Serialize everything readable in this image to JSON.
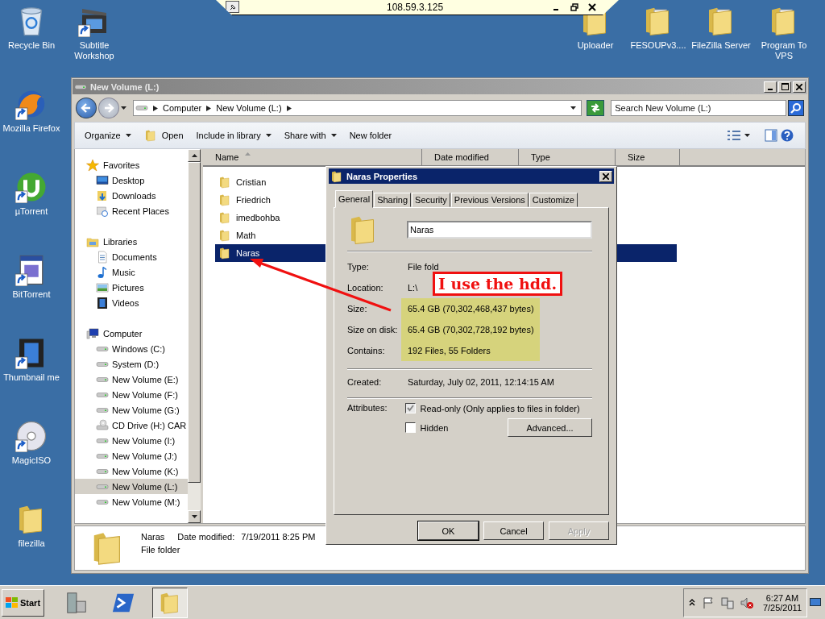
{
  "remote_bar": {
    "title": "108.59.3.125"
  },
  "desktop_left": [
    {
      "label": "Recycle Bin",
      "kind": "recycle"
    },
    {
      "label": "Mozilla Firefox",
      "kind": "browser"
    },
    {
      "label": "µTorrent",
      "kind": "torrent"
    },
    {
      "label": "BitTorrent",
      "kind": "app"
    },
    {
      "label": "Thumbnail me",
      "kind": "film"
    },
    {
      "label": "MagicISO",
      "kind": "disc"
    },
    {
      "label": "filezilla",
      "kind": "folder"
    }
  ],
  "desktop_top": [
    {
      "label": "Subtitle Workshop",
      "kind": "clapper"
    }
  ],
  "desktop_right": [
    {
      "label": "Uploader",
      "kind": "folder"
    },
    {
      "label": "FESOUPv3....",
      "kind": "docfolder"
    },
    {
      "label": "FileZilla Server",
      "kind": "docfolder"
    },
    {
      "label": "Program To VPS",
      "kind": "docfolder"
    }
  ],
  "explorer": {
    "title": "New Volume (L:)",
    "breadcrumb": [
      "Computer",
      "New Volume (L:)"
    ],
    "search": {
      "placeholder": "Search New Volume (L:)"
    },
    "toolbar": [
      {
        "label": "Organize",
        "kind": "command",
        "dropdown": true
      },
      {
        "label": "Open",
        "kind": "open",
        "dropdown": false
      },
      {
        "label": "Include in library",
        "kind": "command",
        "dropdown": true
      },
      {
        "label": "Share with",
        "kind": "command",
        "dropdown": true
      },
      {
        "label": "New folder",
        "kind": "command",
        "dropdown": false
      }
    ],
    "nav": [
      {
        "label": "Favorites",
        "kind": "star",
        "children": [
          {
            "label": "Desktop",
            "kind": "desktop",
            "selected": false
          },
          {
            "label": "Downloads",
            "kind": "downloads",
            "selected": false
          },
          {
            "label": "Recent Places",
            "kind": "recent",
            "selected": false
          }
        ]
      },
      {
        "label": "Libraries",
        "kind": "library",
        "children": [
          {
            "label": "Documents",
            "kind": "document",
            "selected": false
          },
          {
            "label": "Music",
            "kind": "music",
            "selected": false
          },
          {
            "label": "Pictures",
            "kind": "pictures",
            "selected": false
          },
          {
            "label": "Videos",
            "kind": "videos",
            "selected": false
          }
        ]
      },
      {
        "label": "Computer",
        "kind": "computer",
        "children": [
          {
            "label": "Windows (C:)",
            "kind": "drive",
            "selected": false
          },
          {
            "label": "System (D:)",
            "kind": "drive",
            "selected": false
          },
          {
            "label": "New Volume (E:)",
            "kind": "drive",
            "selected": false
          },
          {
            "label": "New Volume (F:)",
            "kind": "drive",
            "selected": false
          },
          {
            "label": "New Volume (G:)",
            "kind": "drive",
            "selected": false
          },
          {
            "label": "CD Drive (H:) CAR",
            "kind": "cd",
            "selected": false
          },
          {
            "label": "New Volume (I:)",
            "kind": "drive",
            "selected": false
          },
          {
            "label": "New Volume (J:)",
            "kind": "drive",
            "selected": false
          },
          {
            "label": "New Volume (K:)",
            "kind": "drive",
            "selected": false
          },
          {
            "label": "New Volume (L:)",
            "kind": "drive",
            "selected": true
          },
          {
            "label": "New Volume (M:)",
            "kind": "drive",
            "selected": false
          }
        ]
      }
    ],
    "columns": [
      {
        "label": "Name",
        "sorted": true
      },
      {
        "label": "Date modified",
        "sorted": false
      },
      {
        "label": "Type",
        "sorted": false
      },
      {
        "label": "Size",
        "sorted": false
      }
    ],
    "files": [
      {
        "name": "Cristian",
        "selected": false
      },
      {
        "name": "Friedrich",
        "selected": false
      },
      {
        "name": "imedbohba",
        "selected": false
      },
      {
        "name": "Math",
        "selected": false
      },
      {
        "name": "Naras",
        "selected": true
      }
    ],
    "details": {
      "name": "Naras",
      "date_label": "Date modified:",
      "date": "7/19/2011 8:25 PM",
      "type": "File folder"
    }
  },
  "dialog": {
    "title": "Naras Properties",
    "tabs": [
      {
        "label": "General",
        "selected": true
      },
      {
        "label": "Sharing",
        "selected": false
      },
      {
        "label": "Security",
        "selected": false
      },
      {
        "label": "Previous Versions",
        "selected": false
      },
      {
        "label": "Customize",
        "selected": false
      }
    ],
    "name_value": "Naras",
    "info_groups": [
      [
        {
          "label": "Type:",
          "value": "File fold",
          "highlight": false
        },
        {
          "label": "Location:",
          "value": "L:\\",
          "highlight": false
        },
        {
          "label": "Size:",
          "value": "65.4 GB (70,302,468,437 bytes)",
          "highlight": true
        },
        {
          "label": "Size on disk:",
          "value": "65.4 GB (70,302,728,192 bytes)",
          "highlight": true
        },
        {
          "label": "Contains:",
          "value": "192 Files, 55 Folders",
          "highlight": true
        }
      ],
      [
        {
          "label": "Created:",
          "value": "Saturday, July 02, 2011, 12:14:15 AM",
          "highlight": false
        }
      ]
    ],
    "attributes": {
      "label": "Attributes:",
      "items": [
        {
          "label": "Read-only (Only applies to files in folder)",
          "checked": true,
          "disabled": true
        },
        {
          "label": "Hidden",
          "checked": false,
          "disabled": false
        }
      ],
      "advanced": "Advanced..."
    },
    "buttons": [
      {
        "label": "OK",
        "default": true,
        "disabled": false
      },
      {
        "label": "Cancel",
        "default": false,
        "disabled": false
      },
      {
        "label": "Apply",
        "default": false,
        "disabled": true
      }
    ]
  },
  "annotation": {
    "text": "I use the hdd."
  },
  "taskbar": {
    "start": "Start",
    "apps": [
      {
        "kind": "server",
        "active": false
      },
      {
        "kind": "terminal",
        "active": false
      },
      {
        "kind": "explorer",
        "active": true
      }
    ],
    "time": "6:27 AM",
    "date": "7/25/2011"
  }
}
